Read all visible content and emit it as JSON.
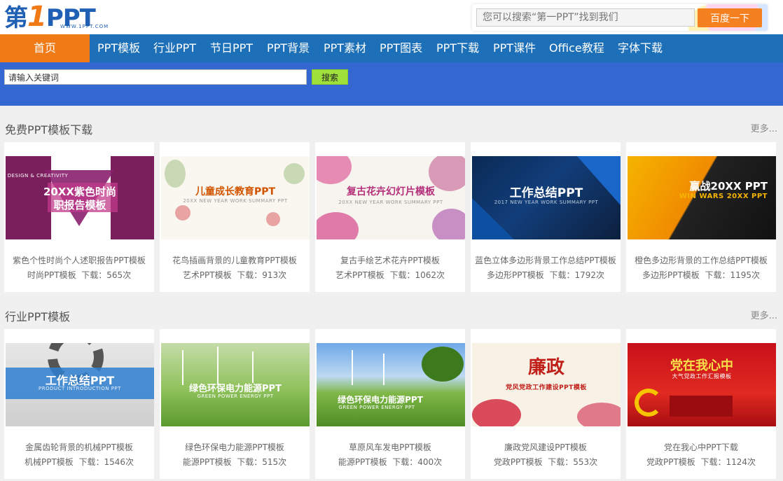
{
  "header": {
    "logo_main": "第",
    "logo_one": "1",
    "logo_ppt": "PPT",
    "logo_url": "WWW.1PPT.COM",
    "search_placeholder": "您可以搜索“第一PPT”找到我们",
    "search_button": "百度一下"
  },
  "nav": {
    "items": [
      "首页",
      "PPT模板",
      "行业PPT",
      "节日PPT",
      "PPT背景",
      "PPT素材",
      "PPT图表",
      "PPT下载",
      "PPT课件",
      "Office教程",
      "字体下载"
    ]
  },
  "keyword_search": {
    "placeholder": "请输入关键词",
    "button": "搜索"
  },
  "sections": [
    {
      "title": "免费PPT模板下载",
      "more": "更多...",
      "cards": [
        {
          "title": "紫色个性时尚个人述职报告PPT模板",
          "category": "时尚PPT模板",
          "downloads_label": "下载：",
          "downloads": "565次",
          "thumb_title": "20XX紫色时尚\n职报告模板",
          "thumb_small": "DESIGN & CREATIVITY"
        },
        {
          "title": "花鸟插画背景的儿童教育PPT模板",
          "category": "艺术PPT模板",
          "downloads_label": "下载：",
          "downloads": "913次",
          "thumb_title": "儿童成长教育PPT",
          "thumb_small": "20XX NEW YEAR WORK SUMMARY PPT"
        },
        {
          "title": "复古手绘艺术花卉PPT模板",
          "category": "艺术PPT模板",
          "downloads_label": "下载：",
          "downloads": "1062次",
          "thumb_title": "复古花卉幻灯片模板",
          "thumb_small": "20XX NEW YEAR WORK SUMMARY PPT"
        },
        {
          "title": "蓝色立体多边形背景工作总结PPT模板",
          "category": "多边形PPT模板",
          "downloads_label": "下载：",
          "downloads": "1792次",
          "thumb_title": "工作总结PPT",
          "thumb_small": "2017 NEW YEAR WORK SUMMARY PPT"
        },
        {
          "title": "橙色多边形背景的工作总结PPT模板",
          "category": "多边形PPT模板",
          "downloads_label": "下载：",
          "downloads": "1195次",
          "thumb_title": "赢战20XX PPT",
          "thumb_small": "WIN WARS 20XX PPT"
        }
      ]
    },
    {
      "title": "行业PPT模板",
      "more": "更多...",
      "cards": [
        {
          "title": "金属齿轮背景的机械PPT模板",
          "category": "机械PPT模板",
          "downloads_label": "下载：",
          "downloads": "1546次",
          "thumb_title": "工作总结PPT",
          "thumb_small": "PRODUCT INTRODUCTION PPT"
        },
        {
          "title": "绿色环保电力能源PPT模板",
          "category": "能源PPT模板",
          "downloads_label": "下载：",
          "downloads": "515次",
          "thumb_title": "绿色环保电力能源PPT",
          "thumb_small": "GREEN POWER ENERGY PPT"
        },
        {
          "title": "草原风车发电PPT模板",
          "category": "能源PPT模板",
          "downloads_label": "下载：",
          "downloads": "400次",
          "thumb_title": "绿色环保电力能源PPT",
          "thumb_small": "GREEN POWER ENERGY PPT"
        },
        {
          "title": "廉政党风建设PPT模板",
          "category": "党政PPT模板",
          "downloads_label": "下载：",
          "downloads": "553次",
          "thumb_title": "廉政",
          "thumb_small": "党风党政工作建设PPT模板"
        },
        {
          "title": "党在我心中PPT下载",
          "category": "党政PPT模板",
          "downloads_label": "下载：",
          "downloads": "1124次",
          "thumb_title": "党在我心中",
          "thumb_small": "大气党政工作汇报模板"
        }
      ]
    }
  ],
  "colors": {
    "nav_bg": "#1d70b8",
    "nav_active": "#f07a16",
    "search_bar": "#3567d3",
    "search_button": "#9fe13a",
    "baidu_button": "#f4801f"
  }
}
